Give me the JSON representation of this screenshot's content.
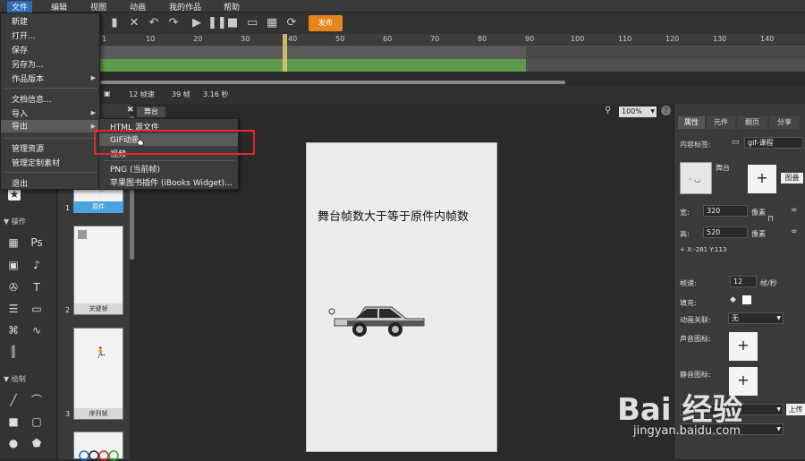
{
  "menubar": {
    "items": [
      "文件",
      "编辑",
      "视图",
      "动画",
      "我的作品",
      "帮助"
    ]
  },
  "toolbar": {
    "publish_label": "发布"
  },
  "timeline": {
    "ticks": [
      "1",
      "10",
      "20",
      "30",
      "40",
      "50",
      "60",
      "70",
      "80",
      "90",
      "100",
      "110",
      "120",
      "130",
      "140"
    ],
    "fps": "12 帧速",
    "frames": "39 帧",
    "duration": "3.16 秒"
  },
  "file_menu": {
    "items": [
      "新建",
      "打开...",
      "保存",
      "另存为...",
      "作品版本",
      "文档信息...",
      "导入",
      "导出",
      "管理资源",
      "管理定制素材",
      "退出"
    ]
  },
  "export_submenu": {
    "items": [
      "HTML 源文件",
      "GIF动画",
      "视频",
      "PNG (当前帧)",
      "苹果图书插件 (iBooks Widget)..."
    ]
  },
  "left_panel": {
    "section_operate": "操作",
    "section_draw": "绘制"
  },
  "frames": {
    "items": [
      {
        "num": "1",
        "label": "原件"
      },
      {
        "num": "2",
        "label": "关键帧"
      },
      {
        "num": "3",
        "label": "序列帧"
      }
    ]
  },
  "stage": {
    "tab_label": "舞台",
    "zoom": "100%",
    "text": "舞台帧数大于等于原件内帧数"
  },
  "right_panel": {
    "tabs": [
      "属性",
      "元件",
      "翻页",
      "分享"
    ],
    "content_label": "内容标签:",
    "content_value": "gif-课程",
    "stage_name": "舞台",
    "image_btn": "图叠",
    "width_label": "宽:",
    "width_value": "320",
    "height_label": "高:",
    "height_value": "520",
    "unit": "像素",
    "coords": "+ X:-281  Y:113",
    "fps_label": "帧速:",
    "fps_value": "12",
    "fps_unit": "帧/秒",
    "fill_label": "填充:",
    "anim_label": "动画关联:",
    "anim_value": "无",
    "sound_label": "声音图标:",
    "mute_label": "静音图标:",
    "upload_label": "上传"
  },
  "watermark": {
    "logo": "Bai 经验",
    "url": "jingyan.baidu.com"
  },
  "colors": {
    "accent": "#2d6bb5",
    "publish": "#e8851c",
    "highlight_box": "#e0282a",
    "timeline_green": "#5c9a4c"
  }
}
